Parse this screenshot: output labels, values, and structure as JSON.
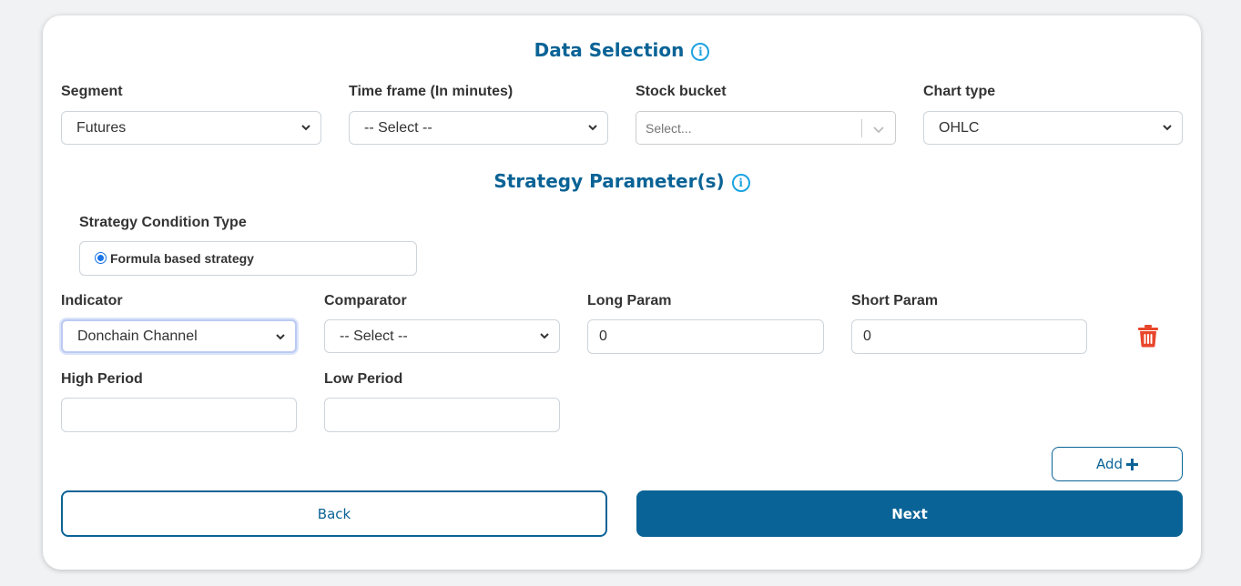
{
  "data_selection": {
    "title": "Data Selection",
    "info_icon": "info-icon",
    "segment": {
      "label": "Segment",
      "value": "Futures"
    },
    "timeframe": {
      "label": "Time frame (In minutes)",
      "value": "-- Select --"
    },
    "stock_bucket": {
      "label": "Stock bucket",
      "placeholder": "Select..."
    },
    "chart_type": {
      "label": "Chart type",
      "value": "OHLC"
    }
  },
  "strategy": {
    "title": "Strategy Parameter(s)",
    "info_icon": "info-icon",
    "condition_type_label": "Strategy Condition Type",
    "condition_option": "Formula based strategy",
    "indicator": {
      "label": "Indicator",
      "value": "Donchain Channel"
    },
    "comparator": {
      "label": "Comparator",
      "value": "-- Select --"
    },
    "long_param": {
      "label": "Long Param",
      "value": "0"
    },
    "short_param": {
      "label": "Short Param",
      "value": "0"
    },
    "high_period": {
      "label": "High Period",
      "value": ""
    },
    "low_period": {
      "label": "Low Period",
      "value": ""
    },
    "delete_icon": "trash-icon"
  },
  "actions": {
    "add_label": "Add",
    "add_icon": "plus-icon",
    "back_label": "Back",
    "next_label": "Next"
  },
  "colors": {
    "primary": "#0a6396",
    "info": "#1ba3e0",
    "danger": "#e8462b"
  }
}
